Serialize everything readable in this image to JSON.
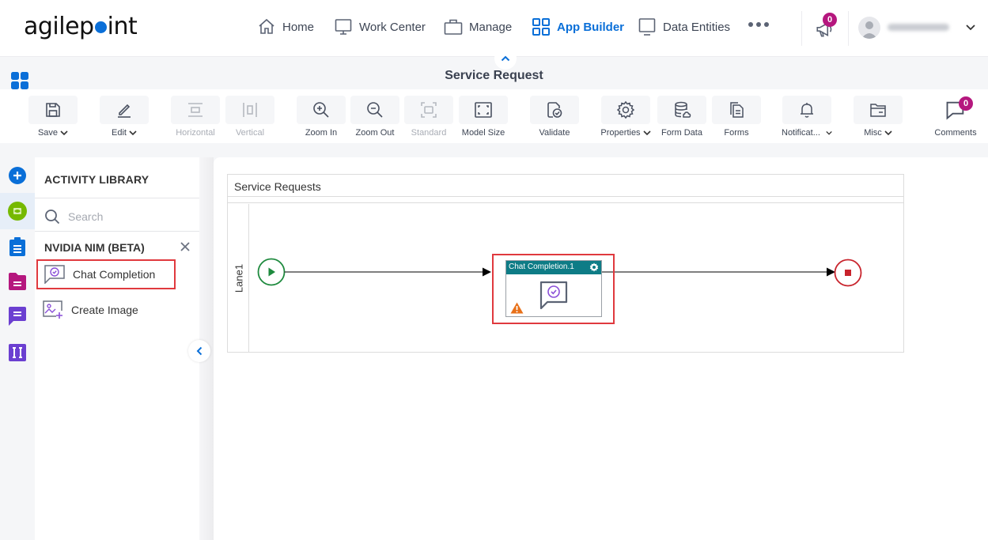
{
  "app": {
    "logo_text_pre": "agilep",
    "logo_text_post": "int",
    "brand_color": "#0a6fd8"
  },
  "nav": {
    "items": [
      {
        "label": "Home",
        "icon": "home-icon",
        "active": false
      },
      {
        "label": "Work Center",
        "icon": "monitor-icon",
        "active": false
      },
      {
        "label": "Manage",
        "icon": "briefcase-icon",
        "active": false
      },
      {
        "label": "App Builder",
        "icon": "grid-icon",
        "active": true
      },
      {
        "label": "Data Entities",
        "icon": "monitor-icon",
        "active": false
      }
    ],
    "more_icon": "more-dots-icon",
    "announcements_badge": "0",
    "user_name": "(blurred)"
  },
  "header": {
    "title": "Service Request"
  },
  "toolbar": {
    "items": [
      {
        "label": "Save",
        "icon": "save-icon",
        "dropdown": true,
        "disabled": false
      },
      {
        "label": "Edit",
        "icon": "pencil-icon",
        "dropdown": true,
        "disabled": false
      },
      {
        "label": "Horizontal",
        "icon": "align-horizontal-icon",
        "dropdown": false,
        "disabled": true
      },
      {
        "label": "Vertical",
        "icon": "align-vertical-icon",
        "dropdown": false,
        "disabled": true
      },
      {
        "label": "Zoom In",
        "icon": "zoom-in-icon",
        "dropdown": false,
        "disabled": false
      },
      {
        "label": "Zoom Out",
        "icon": "zoom-out-icon",
        "dropdown": false,
        "disabled": false
      },
      {
        "label": "Standard",
        "icon": "standard-size-icon",
        "dropdown": false,
        "disabled": true
      },
      {
        "label": "Model Size",
        "icon": "fit-screen-icon",
        "dropdown": false,
        "disabled": false
      },
      {
        "label": "Validate",
        "icon": "validate-icon",
        "dropdown": false,
        "disabled": false
      },
      {
        "label": "Properties",
        "icon": "gear-icon",
        "dropdown": true,
        "disabled": false
      },
      {
        "label": "Form Data",
        "icon": "database-icon",
        "dropdown": false,
        "disabled": false
      },
      {
        "label": "Forms",
        "icon": "forms-icon",
        "dropdown": false,
        "disabled": false
      },
      {
        "label": "Notificat...",
        "icon": "bell-icon",
        "dropdown": true,
        "disabled": false
      },
      {
        "label": "Misc",
        "icon": "folder-icon",
        "dropdown": true,
        "disabled": false
      },
      {
        "label": "Comments",
        "icon": "comment-icon",
        "dropdown": false,
        "disabled": false,
        "badge": "0"
      }
    ]
  },
  "rail": {
    "items": [
      {
        "name": "add-activity",
        "color": "#0a6fd8"
      },
      {
        "name": "nvidia-nim",
        "color": "#76b900",
        "active": true
      },
      {
        "name": "tasks",
        "color": "#0a6fd8"
      },
      {
        "name": "documents",
        "color": "#b5177e"
      },
      {
        "name": "messaging",
        "color": "#6b3fd1"
      },
      {
        "name": "integration",
        "color": "#6b3fd1"
      }
    ]
  },
  "library": {
    "title": "ACTIVITY LIBRARY",
    "search_placeholder": "Search",
    "category": "NVIDIA NIM (BETA)",
    "items": [
      {
        "label": "Chat Completion",
        "icon": "chat-completion-icon",
        "highlighted": true
      },
      {
        "label": "Create Image",
        "icon": "create-image-icon",
        "highlighted": false
      }
    ]
  },
  "canvas": {
    "pool_title": "Service Requests",
    "lane_label": "Lane1",
    "task": {
      "title": "Chat Completion.1",
      "warning": true,
      "highlighted": true
    },
    "colors": {
      "start": "#1e8a3e",
      "end": "#c8232c",
      "task_header": "#0e7c86",
      "warning": "#e8711a",
      "highlight": "#e0393e"
    }
  }
}
